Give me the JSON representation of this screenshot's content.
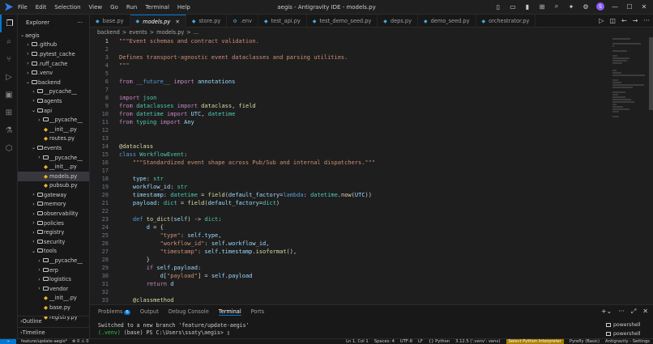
{
  "titlebar": {
    "menu": [
      "File",
      "Edit",
      "Selection",
      "View",
      "Go",
      "Run",
      "Terminal",
      "Help"
    ],
    "title": "aegis - Antigravity IDE - models.py"
  },
  "explorer": {
    "header": "Explorer",
    "tree": [
      {
        "label": "aegis",
        "depth": 0,
        "type": "root",
        "open": true
      },
      {
        "label": ".github",
        "depth": 1,
        "type": "folder",
        "open": false
      },
      {
        "label": ".pytest_cache",
        "depth": 1,
        "type": "folder",
        "open": false
      },
      {
        "label": ".ruff_cache",
        "depth": 1,
        "type": "folder",
        "open": false
      },
      {
        "label": ".venv",
        "depth": 1,
        "type": "folder",
        "open": false
      },
      {
        "label": "backend",
        "depth": 1,
        "type": "folder",
        "open": true
      },
      {
        "label": "__pycache__",
        "depth": 2,
        "type": "folder",
        "open": false
      },
      {
        "label": "agents",
        "depth": 2,
        "type": "folder",
        "open": false
      },
      {
        "label": "api",
        "depth": 2,
        "type": "folder",
        "open": true
      },
      {
        "label": "__pycache__",
        "depth": 3,
        "type": "folder",
        "open": false
      },
      {
        "label": "__init__.py",
        "depth": 3,
        "type": "py"
      },
      {
        "label": "routes.py",
        "depth": 3,
        "type": "py"
      },
      {
        "label": "events",
        "depth": 2,
        "type": "folder",
        "open": true
      },
      {
        "label": "__pycache__",
        "depth": 3,
        "type": "folder",
        "open": false
      },
      {
        "label": "__init__.py",
        "depth": 3,
        "type": "py"
      },
      {
        "label": "models.py",
        "depth": 3,
        "type": "py",
        "selected": true
      },
      {
        "label": "pubsub.py",
        "depth": 3,
        "type": "py"
      },
      {
        "label": "gateway",
        "depth": 2,
        "type": "folder",
        "open": false
      },
      {
        "label": "memory",
        "depth": 2,
        "type": "folder",
        "open": false
      },
      {
        "label": "observability",
        "depth": 2,
        "type": "folder",
        "open": false
      },
      {
        "label": "policies",
        "depth": 2,
        "type": "folder",
        "open": false
      },
      {
        "label": "registry",
        "depth": 2,
        "type": "folder",
        "open": false
      },
      {
        "label": "security",
        "depth": 2,
        "type": "folder",
        "open": false
      },
      {
        "label": "tools",
        "depth": 2,
        "type": "folder",
        "open": true
      },
      {
        "label": "__pycache__",
        "depth": 3,
        "type": "folder",
        "open": false
      },
      {
        "label": "erp",
        "depth": 3,
        "type": "folder",
        "open": false
      },
      {
        "label": "logistics",
        "depth": 3,
        "type": "folder",
        "open": false
      },
      {
        "label": "vendor",
        "depth": 3,
        "type": "folder",
        "open": false
      },
      {
        "label": "__init__.py",
        "depth": 3,
        "type": "py"
      },
      {
        "label": "base.py",
        "depth": 3,
        "type": "py"
      },
      {
        "label": "registry.py",
        "depth": 3,
        "type": "py"
      }
    ],
    "outline": "Outline",
    "timeline": "Timeline"
  },
  "tabs": [
    {
      "label": "base.py",
      "active": false
    },
    {
      "label": "models.py",
      "active": true
    },
    {
      "label": "store.py",
      "active": false
    },
    {
      "label": ".env",
      "active": false
    },
    {
      "label": "test_api.py",
      "active": false
    },
    {
      "label": "test_demo_seed.py",
      "active": false
    },
    {
      "label": "deps.py",
      "active": false
    },
    {
      "label": "demo_seed.py",
      "active": false
    },
    {
      "label": "orchestrator.py",
      "active": false
    }
  ],
  "breadcrumb": [
    "backend",
    ">",
    "events",
    ">",
    "models.py",
    ">",
    "..."
  ],
  "editor": {
    "current_line": 1,
    "lines": [
      {
        "n": 1,
        "t": [
          [
            "str",
            "\"\"\"Event schemas and contract validation."
          ]
        ]
      },
      {
        "n": 2,
        "t": []
      },
      {
        "n": 3,
        "t": [
          [
            "str",
            "Defines transport-agnostic event dataclasses and parsing utilities."
          ]
        ]
      },
      {
        "n": 4,
        "t": [
          [
            "str",
            "\"\"\""
          ]
        ]
      },
      {
        "n": 5,
        "t": []
      },
      {
        "n": 6,
        "t": [
          [
            "kw",
            "from"
          ],
          [
            "",
            " "
          ],
          [
            "kw2",
            "__future__"
          ],
          [
            "",
            " "
          ],
          [
            "kw",
            "import"
          ],
          [
            "",
            " "
          ],
          [
            "var",
            "annotations"
          ]
        ]
      },
      {
        "n": 7,
        "t": []
      },
      {
        "n": 8,
        "t": [
          [
            "kw",
            "import"
          ],
          [
            "",
            " "
          ],
          [
            "cls",
            "json"
          ]
        ]
      },
      {
        "n": 9,
        "t": [
          [
            "kw",
            "from"
          ],
          [
            "",
            " "
          ],
          [
            "cls",
            "dataclasses"
          ],
          [
            "",
            " "
          ],
          [
            "kw",
            "import"
          ],
          [
            "",
            " "
          ],
          [
            "fn",
            "dataclass"
          ],
          [
            "",
            ", "
          ],
          [
            "fn",
            "field"
          ]
        ]
      },
      {
        "n": 10,
        "t": [
          [
            "kw",
            "from"
          ],
          [
            "",
            " "
          ],
          [
            "cls",
            "datetime"
          ],
          [
            "",
            " "
          ],
          [
            "kw",
            "import"
          ],
          [
            "",
            " "
          ],
          [
            "var",
            "UTC"
          ],
          [
            "",
            ", "
          ],
          [
            "cls",
            "datetime"
          ]
        ]
      },
      {
        "n": 11,
        "t": [
          [
            "kw",
            "from"
          ],
          [
            "",
            " "
          ],
          [
            "cls",
            "typing"
          ],
          [
            "",
            " "
          ],
          [
            "kw",
            "import"
          ],
          [
            "",
            " "
          ],
          [
            "var",
            "Any"
          ]
        ]
      },
      {
        "n": 12,
        "t": []
      },
      {
        "n": 13,
        "t": []
      },
      {
        "n": 14,
        "t": [
          [
            "dec",
            "@dataclass"
          ]
        ]
      },
      {
        "n": 15,
        "t": [
          [
            "kw2",
            "class"
          ],
          [
            "",
            " "
          ],
          [
            "cls",
            "WorkflowEvent"
          ],
          [
            "",
            ":"
          ]
        ]
      },
      {
        "n": 16,
        "t": [
          [
            "",
            "    "
          ],
          [
            "str",
            "\"\"\"Standardized event shape across Pub/Sub and internal dispatchers.\"\"\""
          ]
        ]
      },
      {
        "n": 17,
        "t": []
      },
      {
        "n": 18,
        "t": [
          [
            "",
            "    "
          ],
          [
            "var",
            "type"
          ],
          [
            "",
            ": "
          ],
          [
            "cls",
            "str"
          ]
        ]
      },
      {
        "n": 19,
        "t": [
          [
            "",
            "    "
          ],
          [
            "var",
            "workflow_id"
          ],
          [
            "",
            ": "
          ],
          [
            "cls",
            "str"
          ]
        ]
      },
      {
        "n": 20,
        "t": [
          [
            "",
            "    "
          ],
          [
            "var",
            "timestamp"
          ],
          [
            "",
            ": "
          ],
          [
            "cls",
            "datetime"
          ],
          [
            "",
            " = "
          ],
          [
            "fn",
            "field"
          ],
          [
            "",
            "("
          ],
          [
            "var",
            "default_factory"
          ],
          [
            "",
            "="
          ],
          [
            "kw2",
            "lambda"
          ],
          [
            "",
            ": "
          ],
          [
            "cls",
            "datetime"
          ],
          [
            "",
            "."
          ],
          [
            "fn",
            "now"
          ],
          [
            "",
            "("
          ],
          [
            "var",
            "UTC"
          ],
          [
            "",
            "))"
          ]
        ]
      },
      {
        "n": 21,
        "t": [
          [
            "",
            "    "
          ],
          [
            "var",
            "payload"
          ],
          [
            "",
            ": "
          ],
          [
            "cls",
            "dict"
          ],
          [
            "",
            " = "
          ],
          [
            "fn",
            "field"
          ],
          [
            "",
            "("
          ],
          [
            "var",
            "default_factory"
          ],
          [
            "",
            "="
          ],
          [
            "cls",
            "dict"
          ],
          [
            "",
            ")"
          ]
        ]
      },
      {
        "n": 22,
        "t": []
      },
      {
        "n": 23,
        "t": [
          [
            "",
            "    "
          ],
          [
            "kw2",
            "def"
          ],
          [
            "",
            " "
          ],
          [
            "fn",
            "to_dict"
          ],
          [
            "",
            "("
          ],
          [
            "var",
            "self"
          ],
          [
            "",
            ") -> "
          ],
          [
            "cls",
            "dict"
          ],
          [
            "",
            ":"
          ]
        ]
      },
      {
        "n": 24,
        "t": [
          [
            "",
            "        "
          ],
          [
            "var",
            "d"
          ],
          [
            "",
            " = {"
          ]
        ]
      },
      {
        "n": 25,
        "t": [
          [
            "",
            "            "
          ],
          [
            "str",
            "\"type\""
          ],
          [
            "",
            ": "
          ],
          [
            "var",
            "self"
          ],
          [
            "",
            "."
          ],
          [
            "var",
            "type"
          ],
          [
            "",
            ","
          ]
        ]
      },
      {
        "n": 26,
        "t": [
          [
            "",
            "            "
          ],
          [
            "str",
            "\"workflow_id\""
          ],
          [
            "",
            ": "
          ],
          [
            "var",
            "self"
          ],
          [
            "",
            "."
          ],
          [
            "var",
            "workflow_id"
          ],
          [
            "",
            ","
          ]
        ]
      },
      {
        "n": 27,
        "t": [
          [
            "",
            "            "
          ],
          [
            "str",
            "\"timestamp\""
          ],
          [
            "",
            ": "
          ],
          [
            "var",
            "self"
          ],
          [
            "",
            "."
          ],
          [
            "var",
            "timestamp"
          ],
          [
            "",
            "."
          ],
          [
            "fn",
            "isoformat"
          ],
          [
            "",
            "(),"
          ]
        ]
      },
      {
        "n": 28,
        "t": [
          [
            "",
            "        }"
          ]
        ]
      },
      {
        "n": 29,
        "t": [
          [
            "",
            "        "
          ],
          [
            "kw",
            "if"
          ],
          [
            "",
            " "
          ],
          [
            "var",
            "self"
          ],
          [
            "",
            "."
          ],
          [
            "var",
            "payload"
          ],
          [
            "",
            ":"
          ]
        ]
      },
      {
        "n": 30,
        "t": [
          [
            "",
            "            "
          ],
          [
            "var",
            "d"
          ],
          [
            "",
            "["
          ],
          [
            "str",
            "\"payload\""
          ],
          [
            "",
            "] = "
          ],
          [
            "var",
            "self"
          ],
          [
            "",
            "."
          ],
          [
            "var",
            "payload"
          ]
        ]
      },
      {
        "n": 31,
        "t": [
          [
            "",
            "        "
          ],
          [
            "kw",
            "return"
          ],
          [
            "",
            " "
          ],
          [
            "var",
            "d"
          ]
        ]
      },
      {
        "n": 32,
        "t": []
      },
      {
        "n": 33,
        "t": [
          [
            "",
            "    "
          ],
          [
            "dec",
            "@classmethod"
          ]
        ]
      }
    ]
  },
  "panel": {
    "tabs": [
      "Problems",
      "Output",
      "Debug Console",
      "Terminal",
      "Ports"
    ],
    "problems_count": "6",
    "active_tab": "Terminal",
    "terminal_line1": "Switched to a new branch 'feature/update-aegis'",
    "terminal_venv": "(.venv)",
    "terminal_prompt": " (base) PS C:\\Users\\ssaty\\aegis> ",
    "shells": [
      "powershell",
      "powershell"
    ]
  },
  "statusbar": {
    "branch": "feature/update-aegis*",
    "problems": "⊗ 0 ⚠ 0",
    "cursor": "Ln 1, Col 1",
    "spaces": "Spaces: 4",
    "encoding": "UTF-8",
    "eol": "LF",
    "language": "{} Python",
    "version": "3.12.5 ('.venv': venv)",
    "interpreter": "Select Python Interpreter",
    "pyrefly": "Pyrefly (Basic)",
    "settings": "Antigravity - Settings"
  }
}
